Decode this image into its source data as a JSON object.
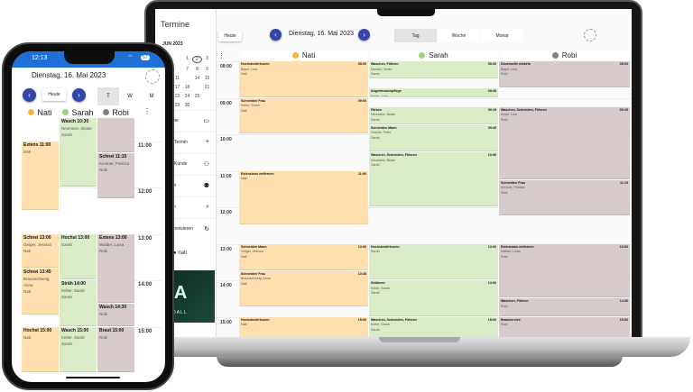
{
  "colors": {
    "nati": "#ffdfad",
    "sarah": "#d9ecc7",
    "robi": "#d6cbca",
    "nati_dot": "#f5b342",
    "sarah_dot": "#a5cf7e",
    "robi_dot": "#8a7c7a",
    "accent": "#3344aa",
    "status_bar": "#1f6fd8"
  },
  "laptop": {
    "sidebar": {
      "title": "Termine",
      "month": "JUN 2023",
      "days": [
        "",
        "",
        "1",
        "2",
        "3",
        "4",
        "",
        "7",
        "8",
        "9",
        "10",
        "11",
        "",
        "14",
        "15",
        "16",
        "17",
        "18",
        "",
        "21",
        "22",
        "23",
        "24",
        "25",
        "",
        "28",
        "29",
        "30"
      ],
      "selected_day": "2",
      "items": [
        {
          "label": "Kalender",
          "icon": "calendar-icon",
          "glyph": "▭"
        },
        {
          "label": "Neuer Termin",
          "icon": "plus-icon",
          "glyph": "+"
        },
        {
          "label": "Neuer Kunde",
          "icon": "person-add-icon",
          "glyph": "⚇"
        },
        {
          "label": "Kunden",
          "icon": "people-icon",
          "glyph": "⚉"
        },
        {
          "label": "Suchen",
          "icon": "search-icon",
          "glyph": "⌕"
        },
        {
          "label": "Synchronisieren",
          "icon": "refresh-icon",
          "glyph": "↻"
        }
      ],
      "user": "nati",
      "logo_text": "ILENDALL"
    },
    "header": {
      "today": "Heute",
      "date": "Dienstag, 16. Mai 2023",
      "prev": "‹",
      "next": "›",
      "tabs": [
        "Tag",
        "Woche",
        "Monat"
      ],
      "active_tab": "Tag"
    },
    "menu_glyph": "⋮",
    "hours": [
      "08:00",
      "09:00",
      "10:00",
      "11:00",
      "12:00",
      "13:00",
      "14:00",
      "15:00"
    ]
  },
  "staff": [
    "Nati",
    "Sarah",
    "Robi"
  ],
  "events": [
    {
      "col": 0,
      "title": "Hochsteckfrisuren",
      "short": "Hochst",
      "start": "08:00",
      "end": "09:00",
      "lines": [
        "Bayer, Lisa",
        "Nati"
      ]
    },
    {
      "col": 0,
      "title": "Schneiden Frau",
      "short": "Schnei",
      "start": "09:00",
      "end": "10:00",
      "lines": [
        "Kelter, Sarah",
        "Nati"
      ]
    },
    {
      "col": 0,
      "title": "Extensions entfernen",
      "short": "Extens",
      "start": "11:00",
      "end": "12:30",
      "lines": [
        "Nati"
      ]
    },
    {
      "col": 0,
      "title": "Schneiden Mann",
      "short": "Schnei",
      "start": "13:00",
      "end": "13:45",
      "lines": [
        "Geiger, Jessica",
        "Nati"
      ]
    },
    {
      "col": 0,
      "title": "Schneiden Frau",
      "short": "Schnei",
      "start": "13:45",
      "end": "14:45",
      "lines": [
        "Braunschweig, Anna",
        "Nati"
      ]
    },
    {
      "col": 0,
      "title": "Hochsteckfrisuren",
      "short": "Hochst",
      "start": "15:00",
      "end": "16:00",
      "lines": [
        "Nati"
      ]
    },
    {
      "col": 1,
      "title": "Waschen, Föhnen",
      "short": "Wasch",
      "start": "08:00",
      "end": "08:30",
      "lines": [
        "Mandel, Vivien",
        "Sarah"
      ]
    },
    {
      "col": 1,
      "title": "Augenbrauenpflege",
      "short": "Augenb",
      "start": "08:45",
      "end": "09:00",
      "lines": [
        "Kelter, Julia"
      ]
    },
    {
      "col": 1,
      "title": "Färben",
      "short": "Färben",
      "start": "09:15",
      "end": "09:45",
      "lines": [
        "Neumann, Beate",
        "Sarah"
      ]
    },
    {
      "col": 1,
      "title": "Schneiden Mann",
      "short": "Schnei",
      "start": "09:45",
      "end": "10:30",
      "lines": [
        "Fischer, Peter",
        "Sarah"
      ]
    },
    {
      "col": 1,
      "title": "Waschen, Schneiden, Föhnen",
      "short": "Wasch",
      "start": "10:30",
      "end": "12:00",
      "lines": [
        "Neumann, Beate",
        "Sarah"
      ]
    },
    {
      "col": 1,
      "title": "Hochsteckfrisuren",
      "short": "Hochst",
      "start": "13:00",
      "end": "14:00",
      "lines": [
        "Sarah"
      ]
    },
    {
      "col": 1,
      "title": "Strähnen",
      "short": "Sträh",
      "start": "14:00",
      "end": "15:00",
      "lines": [
        "Kelter, Sarah",
        "Sarah"
      ]
    },
    {
      "col": 1,
      "title": "Waschen, Schneiden, Föhnen",
      "short": "Wasch",
      "start": "15:00",
      "end": "16:00",
      "lines": [
        "Kelter, Sarah",
        "Sarah"
      ]
    },
    {
      "col": 2,
      "title": "Dauerwelle wickeln",
      "short": "Dauerw",
      "start": "08:00",
      "end": "08:45",
      "lines": [
        "Bayer, Lisa",
        "Robi"
      ]
    },
    {
      "col": 2,
      "title": "Waschen, Schneiden, Föhnen",
      "short": "Wasch",
      "start": "09:15",
      "end": "11:15",
      "lines": [
        "Bayer, Lisa",
        "Robi"
      ]
    },
    {
      "col": 2,
      "title": "Schneiden Frau",
      "short": "Schnei",
      "start": "11:15",
      "end": "12:15",
      "lines": [
        "Kentner, Patrizia",
        "Robi"
      ]
    },
    {
      "col": 2,
      "title": "Extensions entfernen",
      "short": "Extens",
      "start": "13:00",
      "end": "14:30",
      "lines": [
        "Walder, Luisa",
        "Robi"
      ]
    },
    {
      "col": 2,
      "title": "Waschen, Föhnen",
      "short": "Wasch",
      "start": "14:30",
      "end": "15:00",
      "lines": [
        "Robi"
      ]
    },
    {
      "col": 2,
      "title": "Brautservice",
      "short": "Braut",
      "start": "15:00",
      "end": "16:00",
      "lines": [
        "Robi"
      ]
    }
  ],
  "phone": {
    "time": "12:13",
    "battery": "57",
    "date": "Dienstag, 16. Mai 2023",
    "today": "Heute",
    "tabs": [
      "T",
      "W",
      "M"
    ],
    "active_tab": "T",
    "hours": [
      "11:00",
      "12:00",
      "13:00",
      "14:00",
      "15:00"
    ],
    "fab_icon": "menu-icon"
  }
}
